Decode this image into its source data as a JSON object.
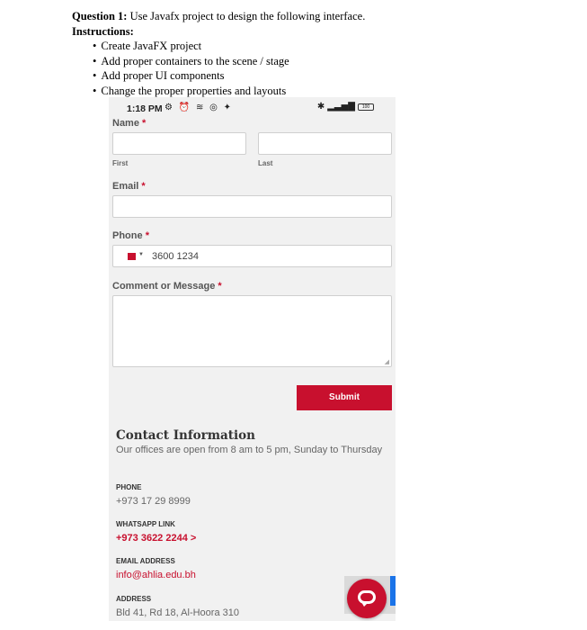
{
  "question": {
    "label": "Question 1:",
    "text": " Use Javafx project to design the following interface.",
    "instructions_label": "Instructions:",
    "items": [
      "Create JavaFX project",
      "Add proper containers to the scene / stage",
      "Add proper UI components",
      "Change the proper properties and layouts"
    ]
  },
  "status": {
    "time": "1:18 PM",
    "battery": "100"
  },
  "form": {
    "name_label": "Name",
    "first_label": "First",
    "last_label": "Last",
    "email_label": "Email",
    "phone_label": "Phone",
    "phone_value": "3600 1234",
    "comment_label": "Comment or Message",
    "required_mark": "*",
    "submit_label": "Submit"
  },
  "contact": {
    "title": "Contact Information",
    "text": "Our offices are open from 8 am to 5 pm, Sunday to Thursday",
    "phone_heading": "PHONE",
    "phone_value": "+973 17 29 8999",
    "whatsapp_heading": "WHATSAPP LINK",
    "whatsapp_value": "+973 3622 2244 >",
    "email_heading": "EMAIL ADDRESS",
    "email_value": "info@ahlia.edu.bh",
    "address_heading": "ADDRESS",
    "address_value": "Bld 41, Rd 18, Al-Hoora 310"
  },
  "colors": {
    "accent": "#c8102e",
    "background": "#f1f1f1"
  }
}
